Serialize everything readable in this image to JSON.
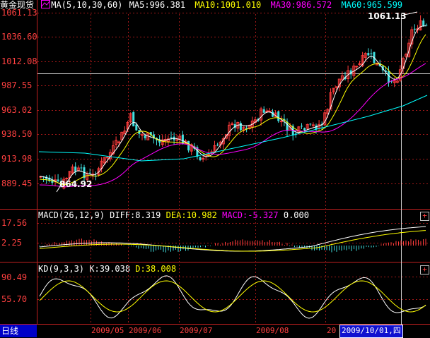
{
  "main": {
    "title": "黄金现货",
    "ma_label": "MA(5,10,30,60)",
    "ma5": "MA5:996.381",
    "ma10": "MA10:1001.010",
    "ma30": "MA30:986.572",
    "ma60": "MA60:965.599",
    "high_tag": "1061.13",
    "low_tag": "864.92",
    "y_ticks": [
      "1061.13",
      "1036.60",
      "1012.08",
      "987.55",
      "963.02",
      "938.50",
      "913.98",
      "889.45"
    ],
    "colors": {
      "up": "#ff3c3c",
      "down": "#40e0e0",
      "ma5": "#ffffff",
      "ma10": "#ffff00",
      "ma30": "#ff00ff",
      "ma60": "#00ffff"
    }
  },
  "macd": {
    "label": "MACD(26,12,9)",
    "diff": "DIFF:8.319",
    "dea": "DEA:10.982",
    "macd": "MACD:-5.327",
    "zero": "0.000",
    "y_ticks": [
      "17.56",
      "2.25"
    ]
  },
  "kd": {
    "label": "KD(9,3,3)",
    "k": "K:39.038",
    "d": "D:38.008",
    "y_ticks": [
      "90.49",
      "55.70"
    ]
  },
  "footer": {
    "period": "日线",
    "months": [
      "2009/05",
      "2009/06",
      "2009/07",
      "2009/08",
      "20"
    ],
    "cursor_date": "2009/10/01,四"
  }
}
